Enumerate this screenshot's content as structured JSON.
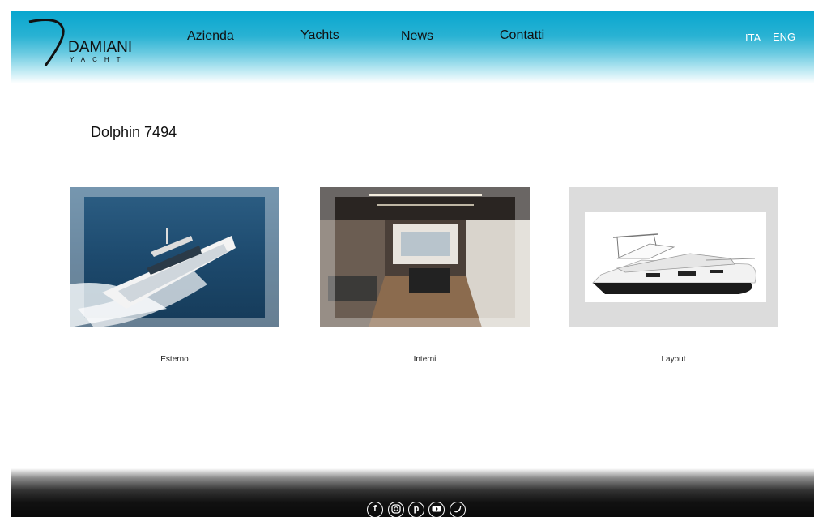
{
  "brand": {
    "name": "DAMIANI",
    "subtitle": "YACHT"
  },
  "nav": {
    "items": [
      {
        "label": "Azienda"
      },
      {
        "label": "Yachts"
      },
      {
        "label": "News"
      },
      {
        "label": "Contatti"
      }
    ]
  },
  "languages": {
    "ita": "ITA",
    "eng": "ENG"
  },
  "page": {
    "title": "Dolphin 7494"
  },
  "gallery": [
    {
      "label": "Esterno",
      "image": "yacht-exterior-photo"
    },
    {
      "label": "Interni",
      "image": "yacht-interior-photo"
    },
    {
      "label": "Layout",
      "image": "yacht-profile-photo"
    }
  ],
  "footer": {
    "social": [
      {
        "icon": "facebook-icon",
        "glyph": "f"
      },
      {
        "icon": "instagram-icon",
        "glyph": ""
      },
      {
        "icon": "pinterest-icon",
        "glyph": "p"
      },
      {
        "icon": "youtube-icon",
        "glyph": ""
      },
      {
        "icon": "twitter-icon",
        "glyph": ""
      }
    ]
  },
  "colors": {
    "header_top": "#07a6cf",
    "footer": "#0a0a0a",
    "lang_text": "#ffffff"
  }
}
